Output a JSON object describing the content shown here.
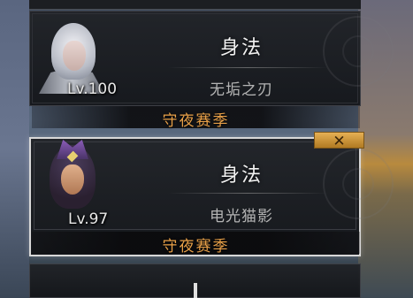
{
  "cards": [
    {
      "level": "Lv.100",
      "title": "身法",
      "subtitle": "无垢之刃",
      "season": "守夜赛季",
      "selected": false
    },
    {
      "level": "Lv.97",
      "title": "身法",
      "subtitle": "电光猫影",
      "season": "守夜赛季",
      "selected": true
    }
  ],
  "close_button": {
    "icon": "close-x-icon",
    "label": "✕"
  },
  "colors": {
    "season_text": "#e8a048",
    "close_button": "#d29a3a",
    "selected_border": "#d8d8d8"
  }
}
